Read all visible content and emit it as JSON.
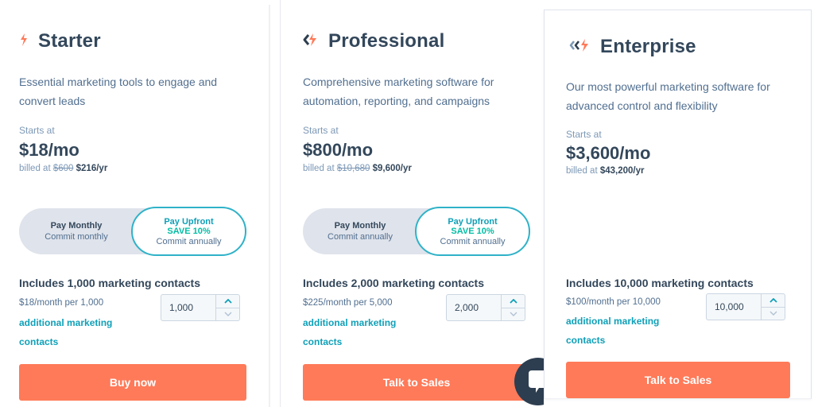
{
  "colors": {
    "accent": "#ff7a59",
    "teal": "#0fa0b8",
    "green": "#00bda5",
    "text": "#33475b",
    "muted": "#516f90"
  },
  "plans": [
    {
      "name": "Starter",
      "icon": "starter-bolt-icon",
      "description_line1": "Essential marketing tools to engage and",
      "description_line2": "convert leads",
      "starts_at": "Starts at",
      "price": "$18/mo",
      "billed_prefix": "billed at",
      "billed_original": "$600",
      "billed_total": "$216/yr",
      "toggle": {
        "left_title": "Pay Monthly",
        "left_sub": "Commit monthly",
        "right_title": "Pay Upfront",
        "right_save": "SAVE 10%",
        "right_sub": "Commit annually"
      },
      "includes": "Includes 1,000 marketing contacts",
      "per": "$18/month per 1,000",
      "additional_line1": "additional marketing",
      "additional_line2": "contacts",
      "contacts_value": "1,000",
      "cta": "Buy now"
    },
    {
      "name": "Professional",
      "icon": "professional-bolt-icon",
      "description_line1": "Comprehensive marketing software for",
      "description_line2": "automation, reporting, and campaigns",
      "starts_at": "Starts at",
      "price": "$800/mo",
      "billed_prefix": "billed at",
      "billed_original": "$10,680",
      "billed_total": "$9,600/yr",
      "toggle": {
        "left_title": "Pay Monthly",
        "left_sub": "Commit annually",
        "right_title": "Pay Upfront",
        "right_save": "SAVE 10%",
        "right_sub": "Commit annually"
      },
      "includes": "Includes 2,000 marketing contacts",
      "per": "$225/month per 5,000",
      "additional_line1": "additional marketing",
      "additional_line2": "contacts",
      "contacts_value": "2,000",
      "cta": "Talk to Sales"
    },
    {
      "name": "Enterprise",
      "icon": "enterprise-bolt-icon",
      "description_line1": "Our most powerful marketing software for",
      "description_line2": "advanced control and flexibility",
      "starts_at": "Starts at",
      "price": "$3,600/mo",
      "billed_prefix": "billed at",
      "billed_total": "$43,200/yr",
      "includes": "Includes 10,000 marketing contacts",
      "per": "$100/month per 10,000",
      "additional_line1": "additional marketing",
      "additional_line2": "contacts",
      "contacts_value": "10,000",
      "cta": "Talk to Sales"
    }
  ],
  "chat_widget": {
    "icon": "chat-bubble-icon"
  }
}
